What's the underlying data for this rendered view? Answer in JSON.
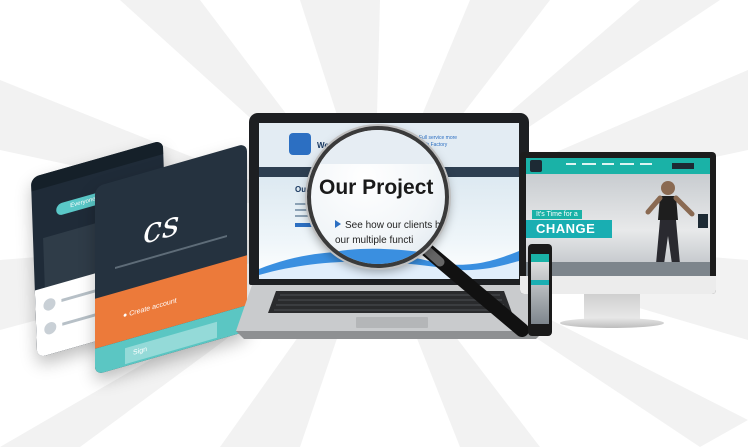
{
  "colors": {
    "accent_teal": "#1ab2a7",
    "accent_orange": "#ec7a3a",
    "laptop_blue": "#2c6fc2",
    "dark_panel": "#25323f"
  },
  "left_phones": {
    "back_chip_label": "Everyone",
    "front_logo": "cs",
    "create_account_label": "Create account",
    "sign_label": "Sign"
  },
  "laptop": {
    "company_name": "We",
    "heading_snippet": "Our P",
    "header_right": "Full service more Web Factory"
  },
  "magnifier": {
    "title": "Our Project",
    "subtitle_line1": "See how our clients h",
    "subtitle_line2": "our multiple functi"
  },
  "monitor": {
    "tagline": "It's Time for a",
    "headline": "CHANGE"
  },
  "icons": {
    "magnifier": "magnifying-glass-icon",
    "carousel_next": "chevron-right-icon"
  }
}
